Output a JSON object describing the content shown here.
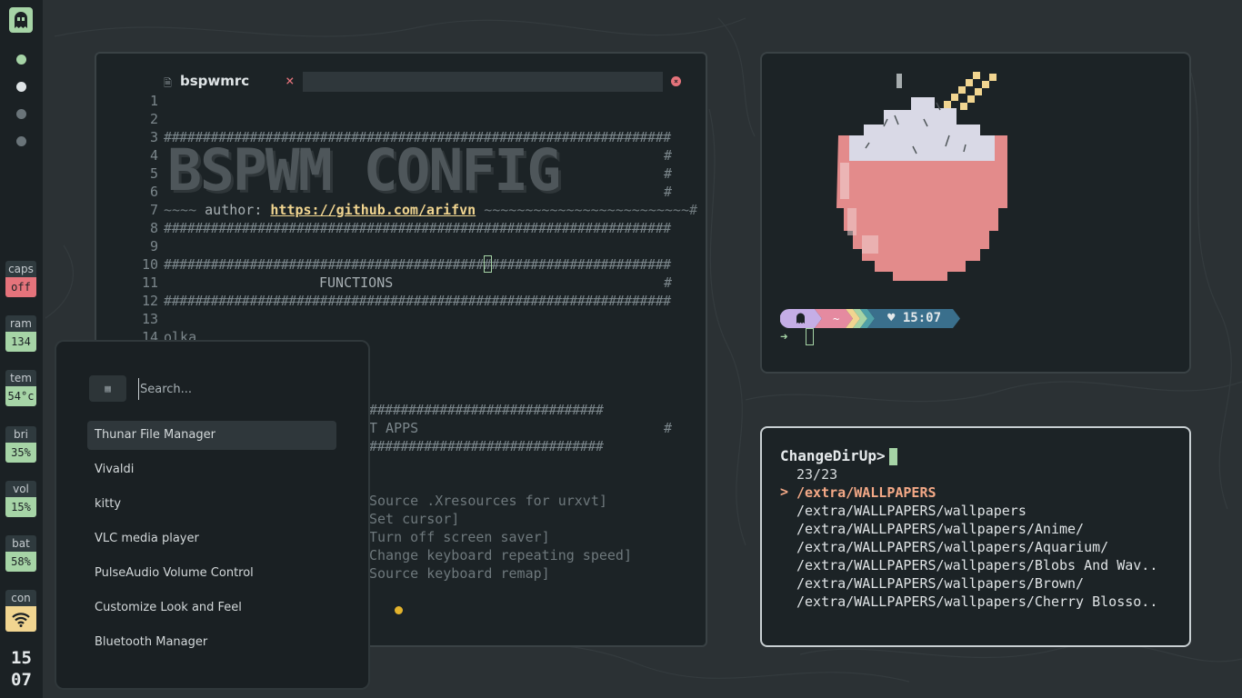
{
  "sidebar": {
    "logo_icon": "ghost-icon",
    "workspaces": [
      {
        "state": "active",
        "color": "#a6d4a6"
      },
      {
        "state": "occupied",
        "color": "#dfe4e6"
      },
      {
        "state": "empty",
        "color": "#6a7479"
      },
      {
        "state": "empty",
        "color": "#6a7479"
      }
    ],
    "stats": [
      {
        "label": "caps",
        "value": "off",
        "color": "#e5737b"
      },
      {
        "label": "ram",
        "value": "134",
        "color": "#a6d4a6"
      },
      {
        "label": "tem",
        "value": "54°c",
        "color": "#a6d4a6"
      },
      {
        "label": "bri",
        "value": "35%",
        "color": "#a6d4a6"
      },
      {
        "label": "vol",
        "value": "15%",
        "color": "#a6d4a6"
      },
      {
        "label": "bat",
        "value": "58%",
        "color": "#a6d4a6"
      },
      {
        "label": "con",
        "value": "",
        "icon": "wifi-icon",
        "color": "#f1d590"
      }
    ],
    "clock": {
      "hour": "15",
      "minute": "07"
    }
  },
  "editor": {
    "tab_title": "bspwmrc",
    "tab_icon": "file-icon",
    "line_numbers": [
      "1",
      "2",
      "3",
      "4",
      "5",
      "6",
      "7",
      "8",
      "9",
      "10",
      "11",
      "12",
      "13",
      "14"
    ],
    "banner": "BSPWM CONFIG",
    "author_label": "author:",
    "author_url": "https://github.com/arifvn",
    "functions_title": "FUNCTIONS",
    "line14_text": "olka",
    "autostart_title": "T APPS",
    "comments": [
      "Source .Xresources for urxvt]",
      "Set cursor]",
      "Turn off screen saver]",
      "Change keyboard repeating speed]",
      "Source keyboard remap]"
    ]
  },
  "launcher": {
    "icon": "grid-icon",
    "placeholder": "Search...",
    "apps": [
      {
        "label": "Thunar File Manager",
        "selected": true
      },
      {
        "label": "Vivaldi"
      },
      {
        "label": "kitty"
      },
      {
        "label": "VLC media player"
      },
      {
        "label": "PulseAudio Volume Control"
      },
      {
        "label": "Customize Look and Feel"
      },
      {
        "label": "Bluetooth Manager"
      }
    ]
  },
  "terminal1": {
    "prompt_time": "♥ 15:07",
    "prompt_arrow": "➜",
    "prompt_colors": [
      "#c5aee6",
      "#e58aa0",
      "#f1d590",
      "#a6d4a6",
      "#4fa0a8",
      "#3a6f8c"
    ]
  },
  "terminal2": {
    "prompt": "ChangeDirUp>",
    "count": "23/23",
    "pointer": ">",
    "entries": [
      "/extra/WALLPAPERS",
      "/extra/WALLPAPERS/wallpapers",
      "/extra/WALLPAPERS/wallpapers/Anime/",
      "/extra/WALLPAPERS/wallpapers/Aquarium/",
      "/extra/WALLPAPERS/wallpapers/Blobs And Wav..",
      "/extra/WALLPAPERS/wallpapers/Brown/",
      "/extra/WALLPAPERS/wallpapers/Cherry Blosso.."
    ]
  }
}
